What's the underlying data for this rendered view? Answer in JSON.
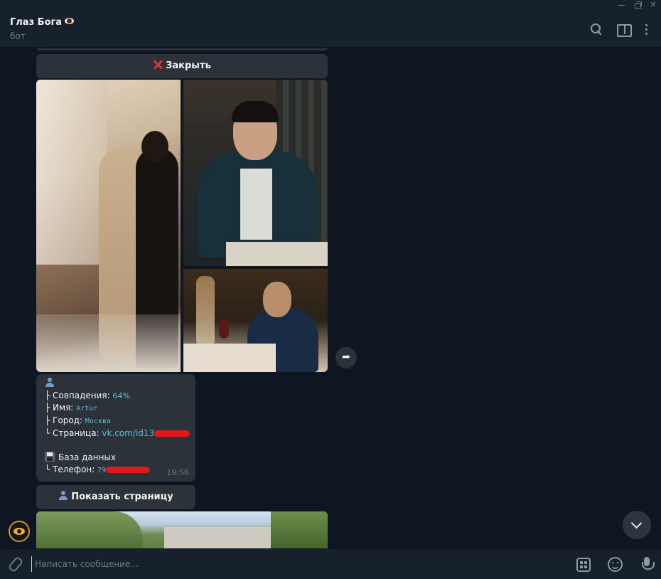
{
  "chat": {
    "title": "Глаз Бога",
    "subtitle": "бот"
  },
  "keyboard": {
    "close_label": "Закрыть",
    "show_page_label": "Показать страницу"
  },
  "result": {
    "matches_label": "├ Совпадения:",
    "matches_value": "64%",
    "name_label": "├ Имя:",
    "name_value": "Artur",
    "city_label": "├ Город:",
    "city_value": "Москва",
    "page_label": "└ Страница:",
    "page_value": "vk.com/id13",
    "db_label": "База данных",
    "phone_label": "└ Телефон:",
    "phone_value": "79",
    "time": "19:56"
  },
  "composer": {
    "placeholder": "Написать сообщение..."
  },
  "icons": {
    "header": [
      "search-icon",
      "sidebar-toggle-icon",
      "more-icon"
    ],
    "composer": [
      "attach-icon",
      "bot-commands-icon",
      "emoji-icon",
      "microphone-icon"
    ]
  },
  "colors": {
    "background": "#0e1621",
    "panel": "#17212b",
    "bubble": "#2b323a",
    "link": "#62bbd2",
    "redaction": "#e01a1a"
  }
}
